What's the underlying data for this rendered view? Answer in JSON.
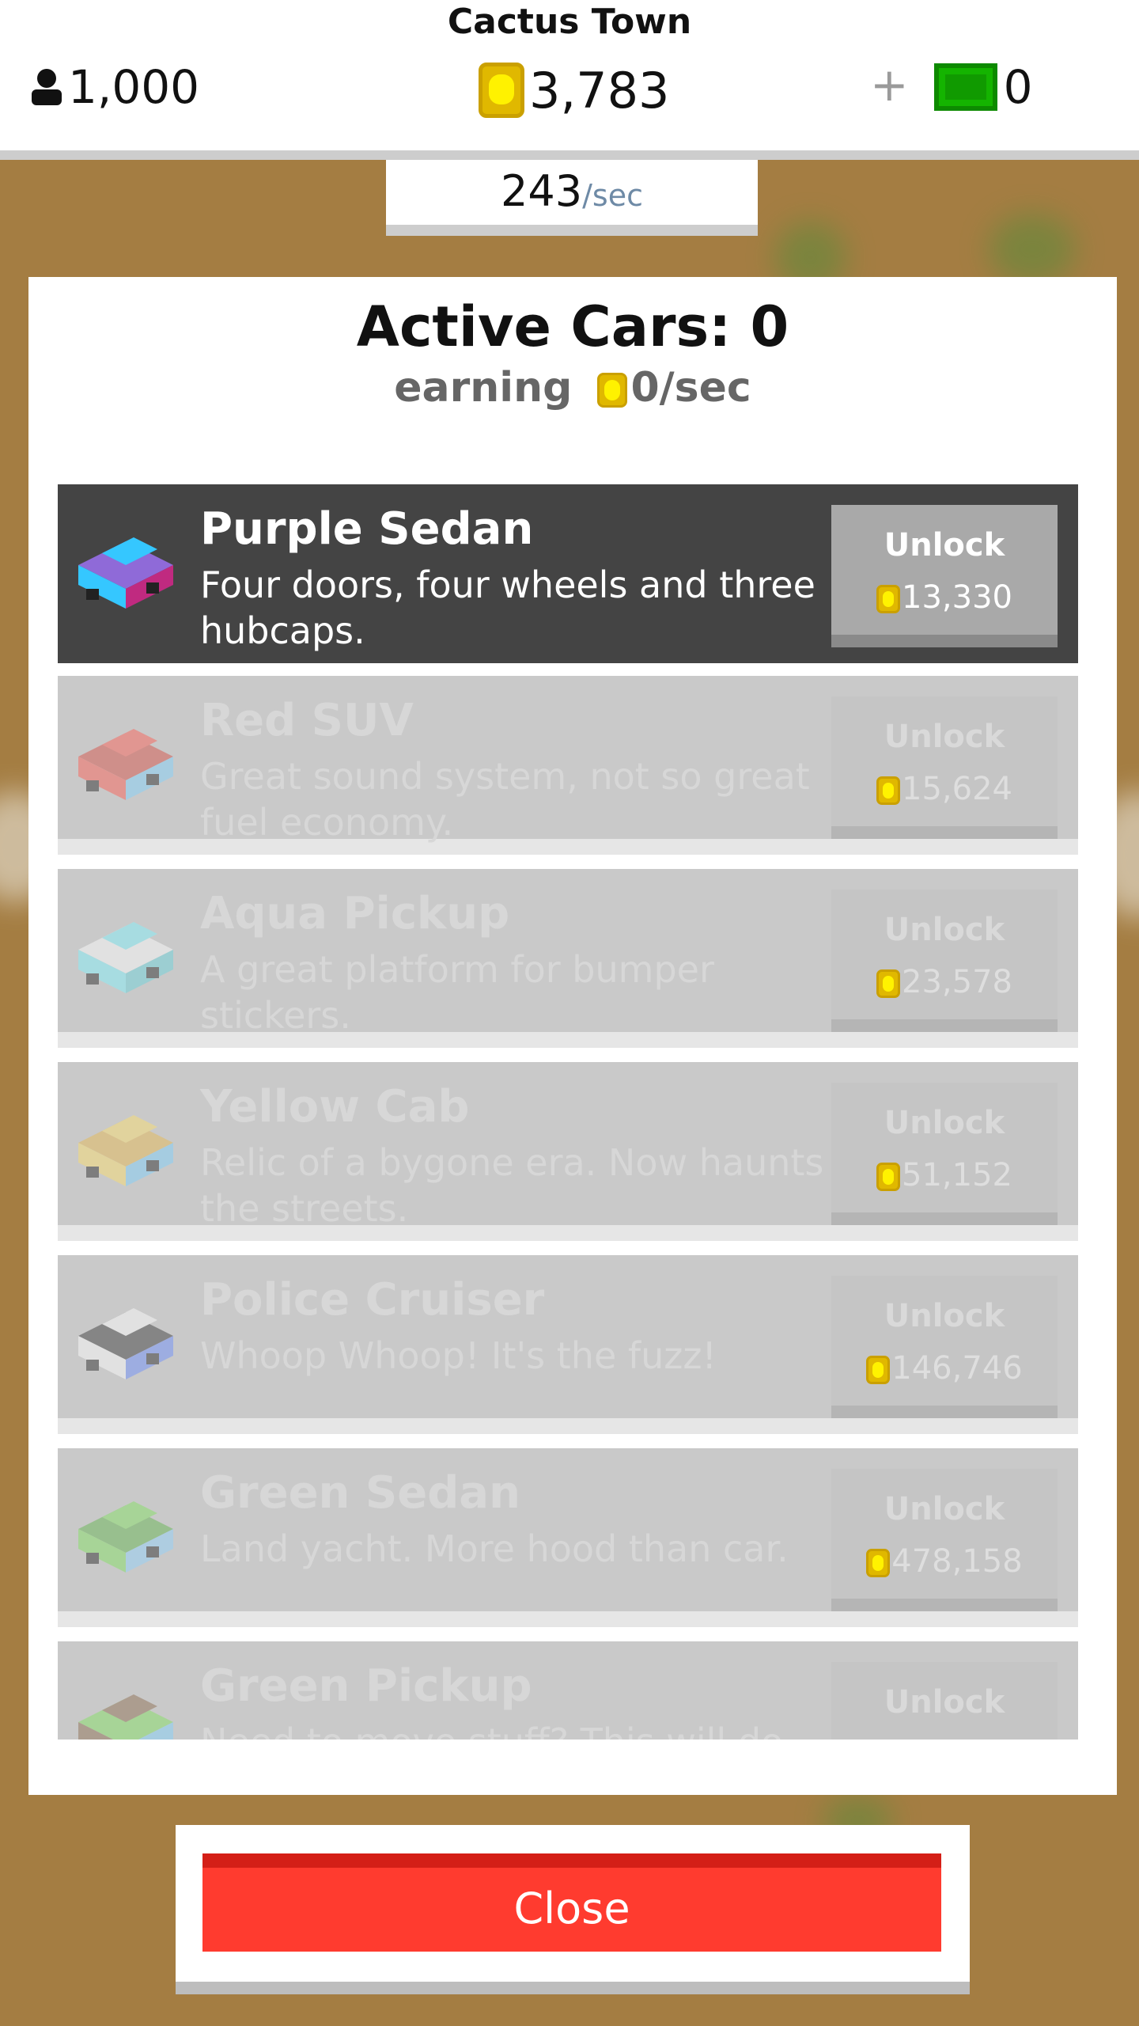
{
  "hud": {
    "town_name": "Cactus Town",
    "population": "1,000",
    "coins": "3,783",
    "plus": "+",
    "cash": "0",
    "rate_value": "243",
    "rate_unit": "/sec"
  },
  "panel": {
    "title": "Active Cars: 0",
    "earning_label": "earning",
    "earning_value": "0/sec"
  },
  "cars": [
    {
      "name": "Purple Sedan",
      "desc": "Four doors, four wheels and three hubcaps.",
      "unlock": "Unlock",
      "cost": "13,330",
      "state": "active",
      "icon": "purple-sedan-icon"
    },
    {
      "name": "Red SUV",
      "desc": "Great sound system, not so great fuel economy.",
      "unlock": "Unlock",
      "cost": "15,624",
      "state": "locked",
      "icon": "red-suv-icon"
    },
    {
      "name": "Aqua Pickup",
      "desc": "A great platform for bumper stickers.",
      "unlock": "Unlock",
      "cost": "23,578",
      "state": "locked",
      "icon": "aqua-pickup-icon"
    },
    {
      "name": "Yellow Cab",
      "desc": "Relic of a bygone era. Now haunts the streets.",
      "unlock": "Unlock",
      "cost": "51,152",
      "state": "locked",
      "icon": "yellow-cab-icon"
    },
    {
      "name": "Police Cruiser",
      "desc": "Whoop Whoop! It's the fuzz!",
      "unlock": "Unlock",
      "cost": "146,746",
      "state": "locked",
      "icon": "police-cruiser-icon"
    },
    {
      "name": "Green Sedan",
      "desc": "Land yacht. More hood than car.",
      "unlock": "Unlock",
      "cost": "478,158",
      "state": "locked",
      "icon": "green-sedan-icon"
    },
    {
      "name": "Green Pickup",
      "desc": "Need to move stuff? This will do the",
      "unlock": "Unlock",
      "cost": "",
      "state": "locked",
      "icon": "green-pickup-icon"
    }
  ],
  "close_label": "Close",
  "colors": {
    "background": "#a47d42",
    "close_button": "#ff3b2f",
    "cash_green": "#14b400",
    "coin_yellow": "#fff200"
  }
}
